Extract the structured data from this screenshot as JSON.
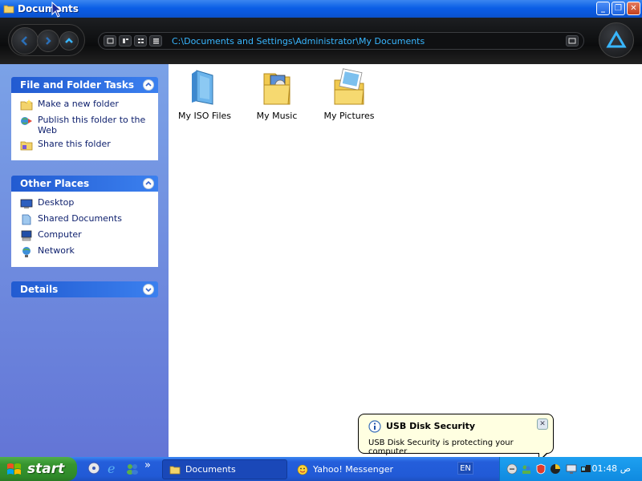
{
  "window": {
    "title": "Documents",
    "buttons": {
      "minimize": "_",
      "maximize": "❐",
      "close": "✕"
    }
  },
  "address": {
    "path": "C:\\Documents and Settings\\Administrator\\My Documents"
  },
  "left_pane": {
    "file_tasks": {
      "title": "File and Folder Tasks",
      "items": [
        {
          "label": "Make a new folder",
          "icon": "new-folder-icon"
        },
        {
          "label": "Publish this folder to the Web",
          "icon": "publish-web-icon"
        },
        {
          "label": "Share this folder",
          "icon": "share-folder-icon"
        }
      ]
    },
    "other_places": {
      "title": "Other Places",
      "items": [
        {
          "label": "Desktop",
          "icon": "desktop-icon"
        },
        {
          "label": "Shared Documents",
          "icon": "shared-documents-icon"
        },
        {
          "label": "Computer",
          "icon": "computer-icon"
        },
        {
          "label": "Network",
          "icon": "network-icon"
        }
      ]
    },
    "details": {
      "title": "Details"
    }
  },
  "folders": [
    {
      "label": "My ISO Files",
      "icon": "iso-folder-icon"
    },
    {
      "label": "My Music",
      "icon": "music-folder-icon"
    },
    {
      "label": "My Pictures",
      "icon": "pictures-folder-icon"
    }
  ],
  "balloon": {
    "title": "USB Disk Security",
    "message": "USB Disk Security is protecting your computer"
  },
  "taskbar": {
    "start_label": "start",
    "overflow": "»",
    "tasks": [
      {
        "label": "Documents",
        "active": true
      },
      {
        "label": "Yahoo! Messenger",
        "active": false
      }
    ],
    "language": "EN",
    "clock": "01:48 ص"
  },
  "colors": {
    "titlebar": "#0b5ee6",
    "toolbar": "#0b0c0d",
    "address_text": "#38b6ff",
    "left_pane": "#6f8ce0",
    "taskbar": "#245edb",
    "start_button": "#37952f",
    "balloon": "#ffffe1"
  }
}
